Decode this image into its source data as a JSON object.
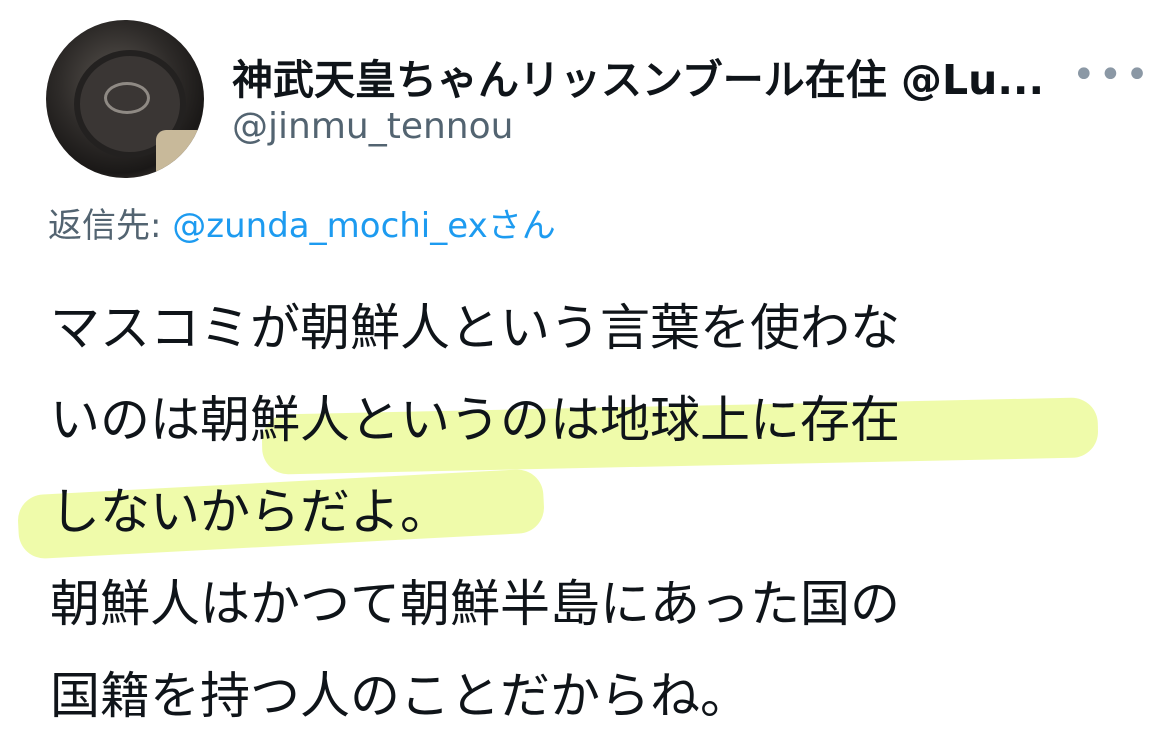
{
  "user": {
    "display_name": "神武天皇ちゃんリッスンブール在住 @Lu...",
    "handle": "@jinmu_tennou"
  },
  "reply": {
    "label": "返信先:",
    "mention": "@zunda_mochi_ex",
    "suffix": "さん"
  },
  "tweet": {
    "lines": [
      "マスコミが朝鮮人という言葉を使わな",
      "いのは朝鮮人というのは地球上に存在",
      "しないからだよ。",
      "朝鮮人はかつて朝鮮半島にあった国の",
      "国籍を持つ人のことだからね。"
    ]
  },
  "icons": {
    "more": "more-horizontal-icon"
  },
  "colors": {
    "text": "#0f1419",
    "secondary": "#536471",
    "link": "#1d9bf0",
    "highlight": "#e2f764"
  }
}
